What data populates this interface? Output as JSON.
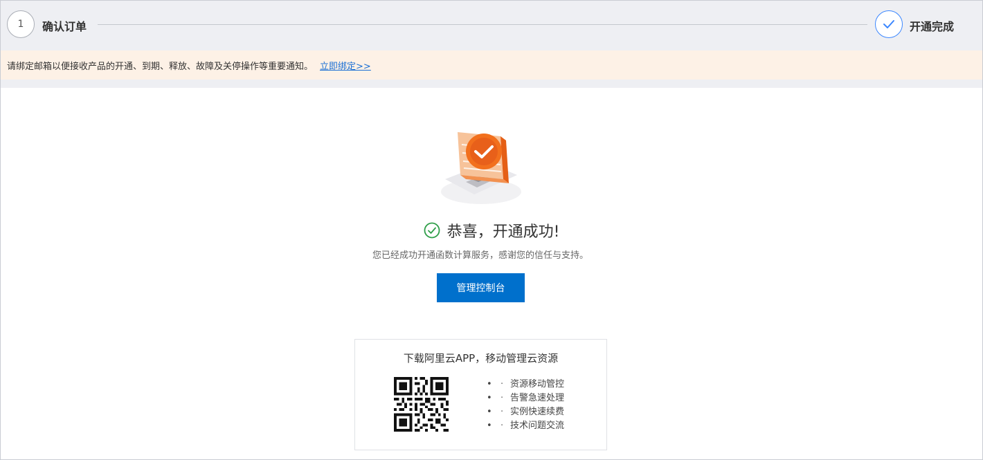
{
  "steps": [
    {
      "number": "1",
      "label": "确认订单",
      "state": "done"
    },
    {
      "label": "开通完成",
      "state": "current"
    }
  ],
  "notice": {
    "text": "请绑定邮箱以便接收产品的开通、到期、释放、故障及关停操作等重要通知。",
    "link": "立即绑定>>"
  },
  "success": {
    "title": "恭喜，开通成功!",
    "subtitle": "您已经成功开通函数计算服务，感谢您的信任与支持。",
    "button": "管理控制台"
  },
  "app": {
    "title": "下载阿里云APP，移动管理云资源",
    "features": [
      "资源移动管控",
      "告警急速处理",
      "实例快速续费",
      "技术问题交流"
    ]
  },
  "colors": {
    "accent": "#0070cc",
    "step_active": "#3a86ff",
    "success_green": "#2e9e48",
    "notice_bg": "#fdf1e6",
    "illustration_orange": "#f2701d"
  }
}
